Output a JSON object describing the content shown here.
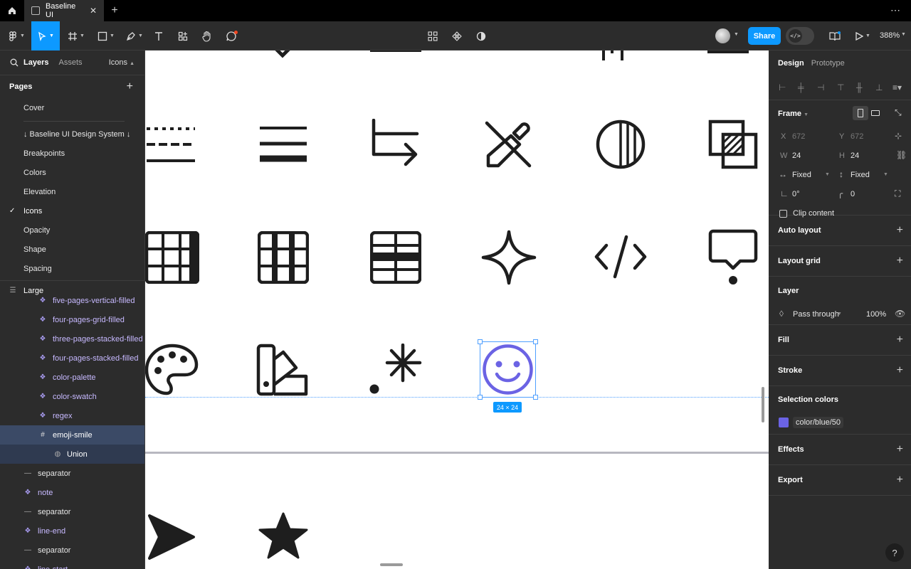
{
  "tabbar": {
    "tab_title": "Baseline UI"
  },
  "toolbar": {
    "share_label": "Share",
    "zoom": "388%",
    "dev_glyph": "</>"
  },
  "left_panel": {
    "tabs": {
      "layers": "Layers",
      "assets": "Assets",
      "page_selector": "Icons"
    },
    "pages_title": "Pages",
    "pages": [
      "Cover",
      "↓ Baseline UI Design System ↓",
      "Breakpoints",
      "Colors",
      "Elevation",
      "Icons",
      "Opacity",
      "Shape",
      "Spacing"
    ],
    "current_page": "Icons",
    "frame_name": "Large",
    "layers": [
      {
        "name": "five-pages-vertical-filled",
        "type": "component"
      },
      {
        "name": "four-pages-grid-filled",
        "type": "component"
      },
      {
        "name": "three-pages-stacked-filled",
        "type": "component"
      },
      {
        "name": "four-pages-stacked-filled",
        "type": "component"
      },
      {
        "name": "color-palette",
        "type": "component"
      },
      {
        "name": "color-swatch",
        "type": "component"
      },
      {
        "name": "regex",
        "type": "component"
      },
      {
        "name": "emoji-smile",
        "type": "frame"
      },
      {
        "name": "Union",
        "type": "union"
      },
      {
        "name": "separator",
        "type": "line"
      },
      {
        "name": "note",
        "type": "component"
      },
      {
        "name": "separator",
        "type": "line"
      },
      {
        "name": "line-end",
        "type": "component"
      },
      {
        "name": "separator",
        "type": "line"
      },
      {
        "name": "line-start",
        "type": "component"
      }
    ]
  },
  "canvas": {
    "selection_size": "24 × 24",
    "selected_icon_color": "#6b63e4"
  },
  "right_panel": {
    "tabs": {
      "design": "Design",
      "prototype": "Prototype"
    },
    "frame": {
      "title": "Frame",
      "x_label": "X",
      "x": "672",
      "y_label": "Y",
      "y": "672",
      "w_label": "W",
      "w": "24",
      "h_label": "H",
      "h": "24",
      "h_sizing": "Fixed",
      "v_sizing": "Fixed",
      "rotation": "0°",
      "radius": "0",
      "clip_content": "Clip content"
    },
    "auto_layout": "Auto layout",
    "layout_grid": "Layout grid",
    "layer": {
      "title": "Layer",
      "blend": "Pass through",
      "opacity": "100%"
    },
    "fill": "Fill",
    "stroke": "Stroke",
    "selection_colors": {
      "title": "Selection colors",
      "color_name": "color/blue/50",
      "color": "#6b63e4"
    },
    "effects": "Effects",
    "export": "Export",
    "help": "?"
  }
}
